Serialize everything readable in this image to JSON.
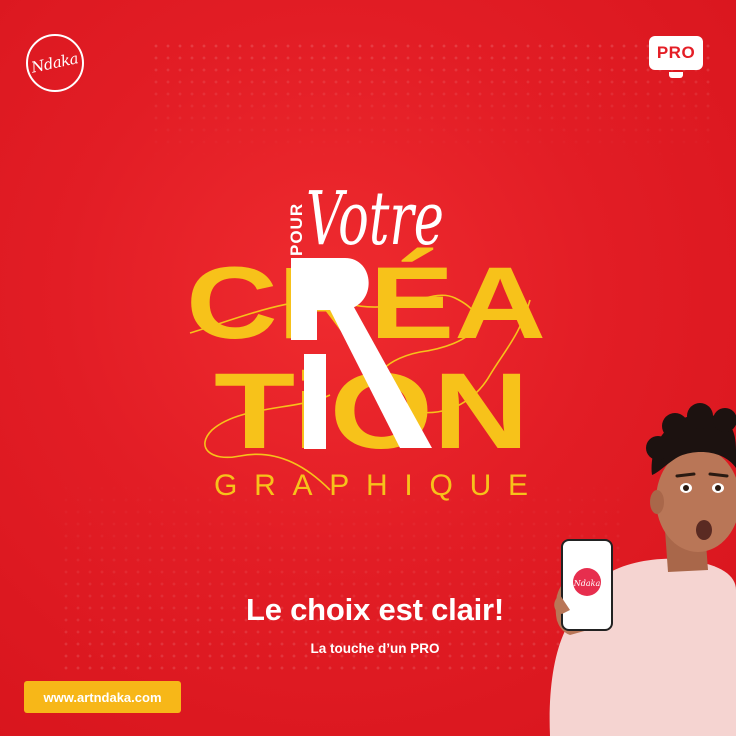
{
  "brand": {
    "logo_text": "Ndaka"
  },
  "badge": {
    "label": "PRO"
  },
  "headline": {
    "pour": "POUR",
    "votre": "Votre",
    "line1": "CRÉA",
    "line2": "TiON",
    "graphique": "GRAPHIQUE"
  },
  "tagline": "Le choix est clair!",
  "subtagline": "La touche d’un PRO",
  "website": "www.artndaka.com",
  "colors": {
    "background": "#e41e26",
    "accent_yellow": "#f7c21a",
    "white": "#ffffff"
  },
  "phone_screen": {
    "logo_text": "Ndaka"
  }
}
